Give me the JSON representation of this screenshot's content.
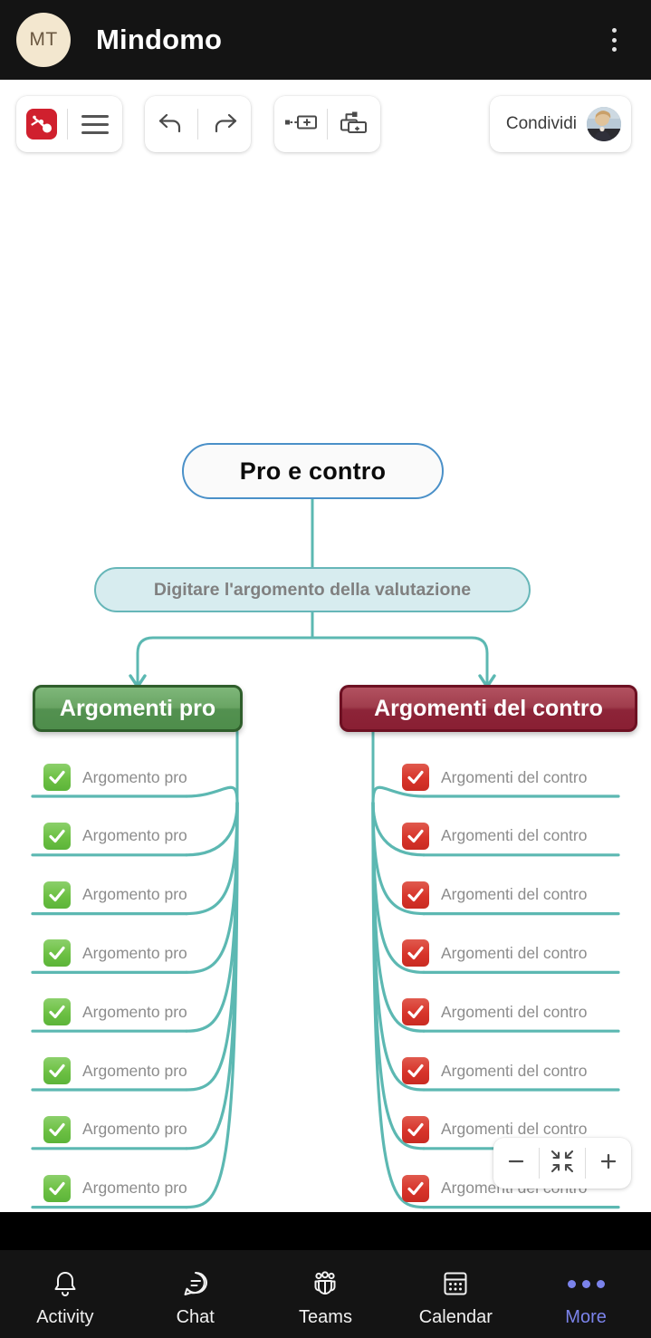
{
  "topbar": {
    "avatar_initials": "MT",
    "title": "Mindomo",
    "overflow_icon": "kebab-menu-icon"
  },
  "toolbar": {
    "logo_icon": "mindomo-logo-icon",
    "menu_icon": "hamburger-menu-icon",
    "undo_icon": "undo-arrow-icon",
    "redo_icon": "redo-arrow-icon",
    "add_sibling_icon": "add-sibling-topic-icon",
    "add_subtopic_icon": "add-subtopic-icon",
    "share_label": "Condividi",
    "share_avatar_icon": "user-avatar-photo"
  },
  "map": {
    "root": "Pro e contro",
    "subtitle": "Digitare l'argomento della valutazione",
    "pro_branch": "Argomenti pro",
    "contro_branch": "Argomenti del contro",
    "pro_leaf_label": "Argomento pro",
    "contro_leaf_label": "Argomenti del contro",
    "pro_leaves": [
      "Argomento pro",
      "Argomento pro",
      "Argomento pro",
      "Argomento pro",
      "Argomento pro",
      "Argomento pro",
      "Argomento pro",
      "Argomento pro"
    ],
    "contro_leaves": [
      "Argomenti del contro",
      "Argomenti del contro",
      "Argomenti del contro",
      "Argomenti del contro",
      "Argomenti del contro",
      "Argomenti del contro",
      "Argomenti del contro",
      "Argomenti del contro"
    ],
    "colors": {
      "connector": "#5cb8b2",
      "root_border": "#4a90c8",
      "subtitle_fill": "#d7ecef",
      "subtitle_border": "#66b6b8",
      "pro_fill": "#539150",
      "pro_border": "#2f5e2b",
      "contro_fill": "#8d2438",
      "contro_border": "#6d1022",
      "check_green": "#6cc043",
      "check_red": "#d7342a",
      "leaf_text": "#8c8c8c"
    }
  },
  "zoom_controls": {
    "zoom_out_icon": "minus-icon",
    "fit_icon": "fit-to-screen-icon",
    "zoom_in_icon": "plus-icon"
  },
  "bottom_nav": {
    "active_color": "#7b83eb",
    "items": [
      {
        "label": "Activity",
        "icon": "bell-icon",
        "active": false
      },
      {
        "label": "Chat",
        "icon": "chat-bubble-icon",
        "active": false
      },
      {
        "label": "Teams",
        "icon": "teams-people-icon",
        "active": false
      },
      {
        "label": "Calendar",
        "icon": "calendar-icon",
        "active": false
      },
      {
        "label": "More",
        "icon": "more-dots-icon",
        "active": true
      }
    ]
  }
}
